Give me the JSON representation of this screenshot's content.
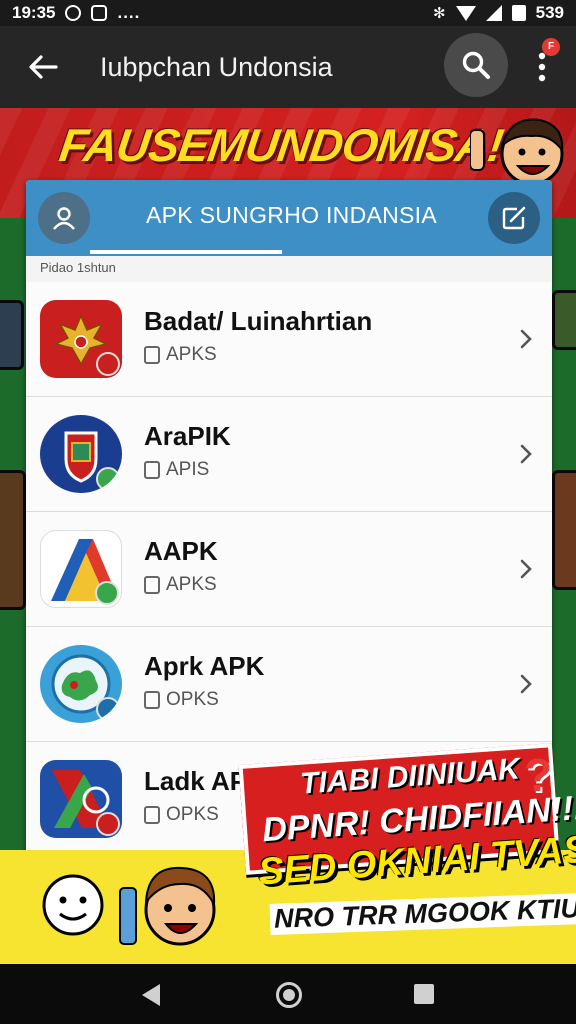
{
  "status_bar": {
    "time": "19:35",
    "dots": "....",
    "bluetooth": "✻",
    "battery_pct": "539"
  },
  "app_bar": {
    "title": "Iubpchan Undonsia",
    "notification": "F"
  },
  "banner": {
    "headline": "FAUSEMUNDOMISA!"
  },
  "panel": {
    "title": "APK SUNGRHO INDANSIA",
    "section_label": "Pidao 1shtun"
  },
  "apps": [
    {
      "name": "Badat/ Luinahrtian",
      "sub": "APKS",
      "icon": "garuda-emblem-icon",
      "bg": "#c9201f"
    },
    {
      "name": "AraPIK",
      "sub": "APIS",
      "icon": "shield-emblem-icon",
      "bg": "#1a3d8f"
    },
    {
      "name": "AAPK",
      "sub": "APKS",
      "icon": "triangle-logo-icon",
      "bg": "#ffffff"
    },
    {
      "name": "Aprk APK",
      "sub": "OPKS",
      "icon": "map-globe-icon",
      "bg": "#3aa0d8"
    },
    {
      "name": "Ladk APK",
      "sub": "OPKS",
      "icon": "diagonal-logo-icon",
      "bg": "#1f4fa6"
    }
  ],
  "promo": {
    "line1": "TIABI DIINIUAK",
    "line2": "DPNR! CHIDFIIAN!!!",
    "line3": "SED OKNIAI TVAS",
    "line4": "NRO TRR MGOOK KTIU!!!",
    "question": "?"
  },
  "colors": {
    "header_blue": "#3d8fc6",
    "banner_red": "#d52020",
    "banner_yellow": "#ffdd22",
    "promo_yellow": "#f6e431",
    "app_bar": "#262626"
  }
}
